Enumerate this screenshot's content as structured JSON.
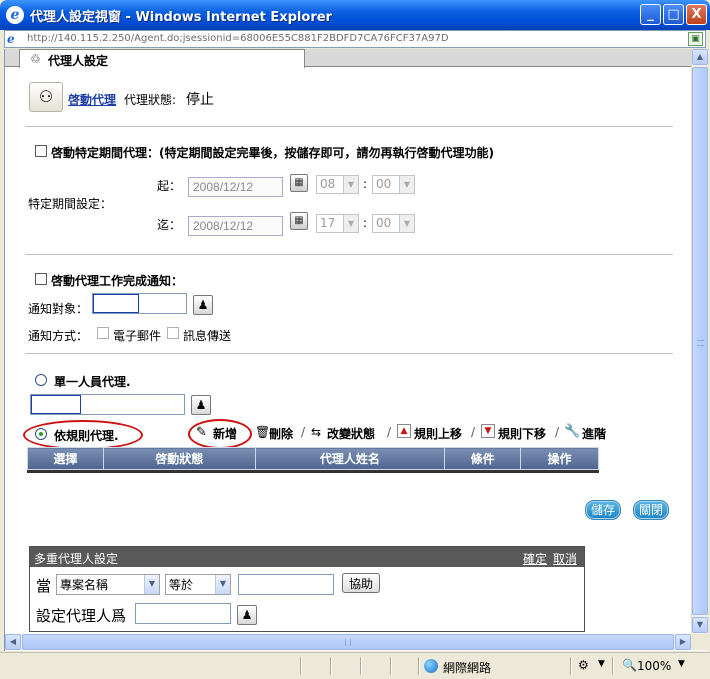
{
  "window": {
    "title": "代理人設定視窗 - Windows Internet Explorer",
    "minimize": "_",
    "maximize": "□",
    "close": "X"
  },
  "address": {
    "url": "http://140.115.2.250/Agent.do;jsessionid=68006E55C881F2BDFD7CA76FCF37A97D"
  },
  "tab": {
    "label": "代理人設定"
  },
  "agent": {
    "start_link": "啓動代理",
    "status_label": "代理狀態:",
    "status_value": "停止"
  },
  "period": {
    "checkbox_label": "啓動特定期間代理：(特定期間設定完畢後，按儲存即可，請勿再執行啓動代理功能)",
    "section_label": "特定期間設定：",
    "start_label": "起：",
    "start_date": "2008/12/12",
    "start_hour": "08",
    "start_minute": "00",
    "end_label": "迄：",
    "end_date": "2008/12/12",
    "end_hour": "17",
    "end_minute": "00",
    "colon": ":"
  },
  "notify": {
    "checkbox_label": "啓動代理工作完成通知：",
    "target_label": "通知對象：",
    "method_label": "通知方式：",
    "email_label": "電子郵件",
    "message_label": "訊息傳送"
  },
  "single": {
    "radio_label": "單一人員代理."
  },
  "rule": {
    "radio_label": "依規則代理.",
    "toolbar": {
      "add": "新增",
      "delete": "刪除",
      "change_status": "改變狀態",
      "rule_up": "規則上移",
      "rule_down": "規則下移",
      "advanced": "進階",
      "separator": "/"
    },
    "columns": [
      "選擇",
      "啓動狀態",
      "代理人姓名",
      "條件",
      "操作"
    ]
  },
  "actions": {
    "save": "儲存",
    "close": "關閉"
  },
  "multi": {
    "title": "多重代理人設定",
    "confirm": "確定",
    "cancel": "取消",
    "when_label": "當",
    "field_select": "專案名稱",
    "operator_select": "等於",
    "value": "",
    "help_button": "協助",
    "set_agent_label": "設定代理人爲"
  },
  "statusbar": {
    "zone": "網際網路",
    "zoom": "100%"
  },
  "colors": {
    "titlebar": "#0a5fe0",
    "link": "#1c3ea6",
    "grid_header": "#5a6f99",
    "highlight_ellipse": "#cc1111",
    "action_button": "#1d83c4"
  }
}
